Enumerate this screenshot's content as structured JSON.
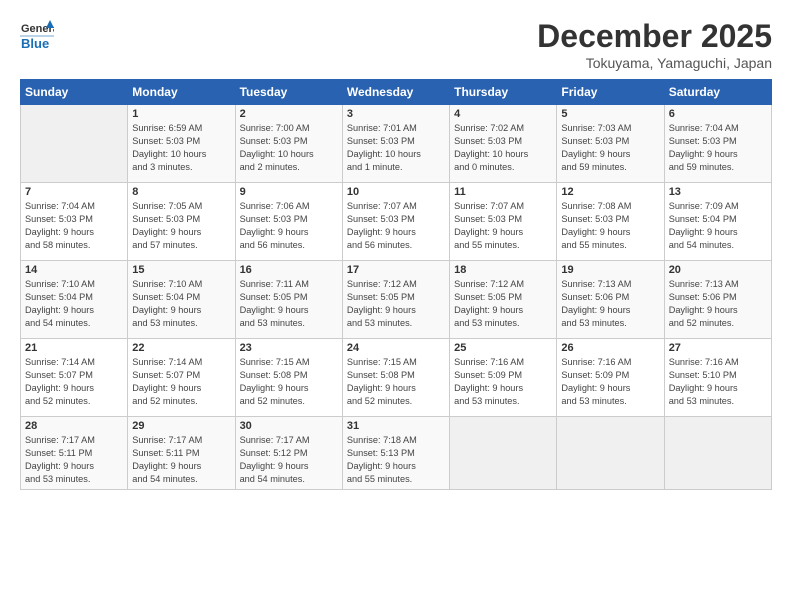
{
  "header": {
    "logo_line1": "General",
    "logo_line2": "Blue",
    "month_year": "December 2025",
    "location": "Tokuyama, Yamaguchi, Japan"
  },
  "days_of_week": [
    "Sunday",
    "Monday",
    "Tuesday",
    "Wednesday",
    "Thursday",
    "Friday",
    "Saturday"
  ],
  "weeks": [
    [
      {
        "day": "",
        "info": ""
      },
      {
        "day": "1",
        "info": "Sunrise: 6:59 AM\nSunset: 5:03 PM\nDaylight: 10 hours\nand 3 minutes."
      },
      {
        "day": "2",
        "info": "Sunrise: 7:00 AM\nSunset: 5:03 PM\nDaylight: 10 hours\nand 2 minutes."
      },
      {
        "day": "3",
        "info": "Sunrise: 7:01 AM\nSunset: 5:03 PM\nDaylight: 10 hours\nand 1 minute."
      },
      {
        "day": "4",
        "info": "Sunrise: 7:02 AM\nSunset: 5:03 PM\nDaylight: 10 hours\nand 0 minutes."
      },
      {
        "day": "5",
        "info": "Sunrise: 7:03 AM\nSunset: 5:03 PM\nDaylight: 9 hours\nand 59 minutes."
      },
      {
        "day": "6",
        "info": "Sunrise: 7:04 AM\nSunset: 5:03 PM\nDaylight: 9 hours\nand 59 minutes."
      }
    ],
    [
      {
        "day": "7",
        "info": "Sunrise: 7:04 AM\nSunset: 5:03 PM\nDaylight: 9 hours\nand 58 minutes."
      },
      {
        "day": "8",
        "info": "Sunrise: 7:05 AM\nSunset: 5:03 PM\nDaylight: 9 hours\nand 57 minutes."
      },
      {
        "day": "9",
        "info": "Sunrise: 7:06 AM\nSunset: 5:03 PM\nDaylight: 9 hours\nand 56 minutes."
      },
      {
        "day": "10",
        "info": "Sunrise: 7:07 AM\nSunset: 5:03 PM\nDaylight: 9 hours\nand 56 minutes."
      },
      {
        "day": "11",
        "info": "Sunrise: 7:07 AM\nSunset: 5:03 PM\nDaylight: 9 hours\nand 55 minutes."
      },
      {
        "day": "12",
        "info": "Sunrise: 7:08 AM\nSunset: 5:03 PM\nDaylight: 9 hours\nand 55 minutes."
      },
      {
        "day": "13",
        "info": "Sunrise: 7:09 AM\nSunset: 5:04 PM\nDaylight: 9 hours\nand 54 minutes."
      }
    ],
    [
      {
        "day": "14",
        "info": "Sunrise: 7:10 AM\nSunset: 5:04 PM\nDaylight: 9 hours\nand 54 minutes."
      },
      {
        "day": "15",
        "info": "Sunrise: 7:10 AM\nSunset: 5:04 PM\nDaylight: 9 hours\nand 53 minutes."
      },
      {
        "day": "16",
        "info": "Sunrise: 7:11 AM\nSunset: 5:05 PM\nDaylight: 9 hours\nand 53 minutes."
      },
      {
        "day": "17",
        "info": "Sunrise: 7:12 AM\nSunset: 5:05 PM\nDaylight: 9 hours\nand 53 minutes."
      },
      {
        "day": "18",
        "info": "Sunrise: 7:12 AM\nSunset: 5:05 PM\nDaylight: 9 hours\nand 53 minutes."
      },
      {
        "day": "19",
        "info": "Sunrise: 7:13 AM\nSunset: 5:06 PM\nDaylight: 9 hours\nand 53 minutes."
      },
      {
        "day": "20",
        "info": "Sunrise: 7:13 AM\nSunset: 5:06 PM\nDaylight: 9 hours\nand 52 minutes."
      }
    ],
    [
      {
        "day": "21",
        "info": "Sunrise: 7:14 AM\nSunset: 5:07 PM\nDaylight: 9 hours\nand 52 minutes."
      },
      {
        "day": "22",
        "info": "Sunrise: 7:14 AM\nSunset: 5:07 PM\nDaylight: 9 hours\nand 52 minutes."
      },
      {
        "day": "23",
        "info": "Sunrise: 7:15 AM\nSunset: 5:08 PM\nDaylight: 9 hours\nand 52 minutes."
      },
      {
        "day": "24",
        "info": "Sunrise: 7:15 AM\nSunset: 5:08 PM\nDaylight: 9 hours\nand 52 minutes."
      },
      {
        "day": "25",
        "info": "Sunrise: 7:16 AM\nSunset: 5:09 PM\nDaylight: 9 hours\nand 53 minutes."
      },
      {
        "day": "26",
        "info": "Sunrise: 7:16 AM\nSunset: 5:09 PM\nDaylight: 9 hours\nand 53 minutes."
      },
      {
        "day": "27",
        "info": "Sunrise: 7:16 AM\nSunset: 5:10 PM\nDaylight: 9 hours\nand 53 minutes."
      }
    ],
    [
      {
        "day": "28",
        "info": "Sunrise: 7:17 AM\nSunset: 5:11 PM\nDaylight: 9 hours\nand 53 minutes."
      },
      {
        "day": "29",
        "info": "Sunrise: 7:17 AM\nSunset: 5:11 PM\nDaylight: 9 hours\nand 54 minutes."
      },
      {
        "day": "30",
        "info": "Sunrise: 7:17 AM\nSunset: 5:12 PM\nDaylight: 9 hours\nand 54 minutes."
      },
      {
        "day": "31",
        "info": "Sunrise: 7:18 AM\nSunset: 5:13 PM\nDaylight: 9 hours\nand 55 minutes."
      },
      {
        "day": "",
        "info": ""
      },
      {
        "day": "",
        "info": ""
      },
      {
        "day": "",
        "info": ""
      }
    ]
  ]
}
